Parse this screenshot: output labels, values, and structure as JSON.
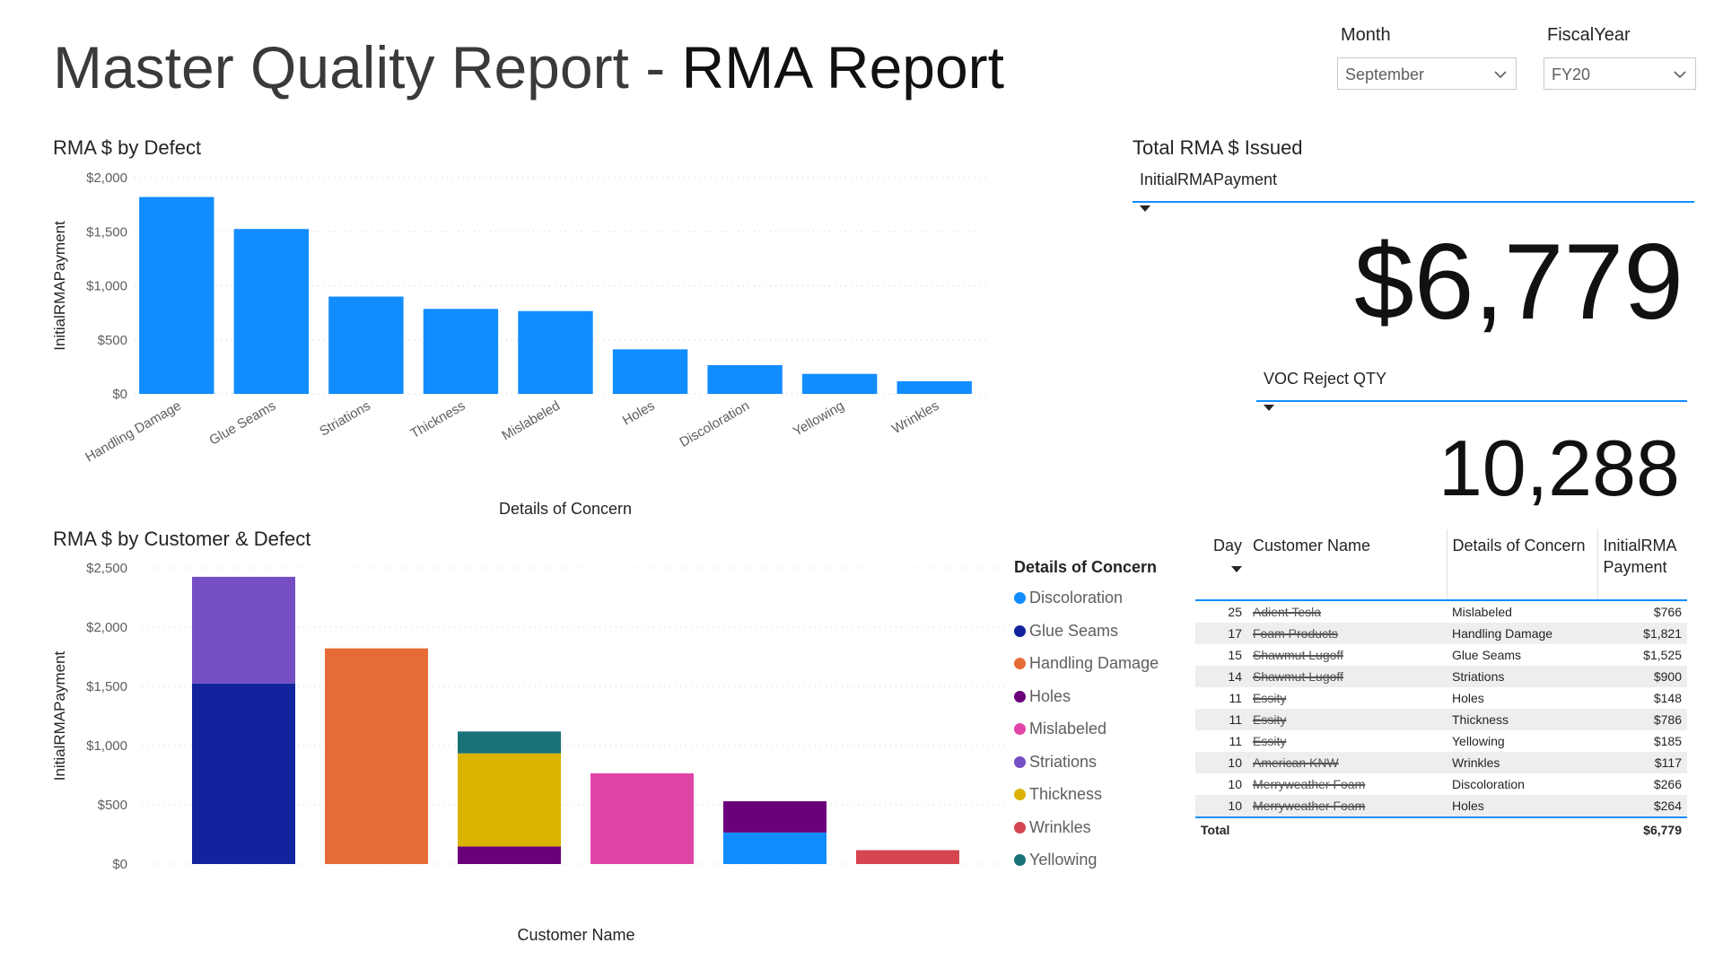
{
  "report": {
    "title_light": "Master Quality Report - ",
    "title_strong": "RMA Report"
  },
  "slicers": [
    {
      "label": "Month",
      "value": "September"
    },
    {
      "label": "FiscalYear",
      "value": "FY20"
    }
  ],
  "cards": {
    "total_title": "Total RMA $ Issued",
    "total_field": "InitialRMAPayment",
    "total_value": "$6,779",
    "voc_field": "VOC Reject QTY",
    "voc_value": "10,288"
  },
  "chart_data": [
    {
      "type": "bar",
      "title": "RMA $ by Defect",
      "xlabel": "Details of Concern",
      "ylabel": "InitialRMAPayment",
      "categories": [
        "Handling Damage",
        "Glue Seams",
        "Striations",
        "Thickness",
        "Mislabeled",
        "Holes",
        "Discoloration",
        "Yellowing",
        "Wrinkles"
      ],
      "values": [
        1821,
        1525,
        900,
        786,
        766,
        412,
        266,
        185,
        117
      ],
      "ylim": [
        0,
        2000
      ],
      "yticks": [
        "$0",
        "$500",
        "$1,000",
        "$1,500",
        "$2,000"
      ],
      "color": "#118dff",
      "grid": true
    },
    {
      "type": "bar",
      "stacked": true,
      "title": "RMA $ by Customer & Defect",
      "xlabel": "Customer Name",
      "ylabel": "InitialRMAPayment",
      "ylim": [
        0,
        2500
      ],
      "yticks": [
        "$0",
        "$500",
        "$1,000",
        "$1,500",
        "$2,000",
        "$2,500"
      ],
      "legend_title": "Details of Concern",
      "legend": [
        {
          "name": "Discoloration",
          "color": "#118dff"
        },
        {
          "name": "Glue Seams",
          "color": "#12239e"
        },
        {
          "name": "Handling Damage",
          "color": "#e66c37"
        },
        {
          "name": "Holes",
          "color": "#6b007b"
        },
        {
          "name": "Mislabeled",
          "color": "#e044a7"
        },
        {
          "name": "Striations",
          "color": "#744ec2"
        },
        {
          "name": "Thickness",
          "color": "#d9b300"
        },
        {
          "name": "Wrinkles",
          "color": "#d64550"
        },
        {
          "name": "Yellowing",
          "color": "#197278"
        }
      ],
      "stacks": [
        [
          {
            "series": "Glue Seams",
            "value": 1525
          },
          {
            "series": "Striations",
            "value": 900
          }
        ],
        [
          {
            "series": "Handling Damage",
            "value": 1821
          }
        ],
        [
          {
            "series": "Holes",
            "value": 148
          },
          {
            "series": "Thickness",
            "value": 786
          },
          {
            "series": "Yellowing",
            "value": 185
          }
        ],
        [
          {
            "series": "Mislabeled",
            "value": 766
          }
        ],
        [
          {
            "series": "Discoloration",
            "value": 266
          },
          {
            "series": "Holes",
            "value": 264
          }
        ],
        [
          {
            "series": "Wrinkles",
            "value": 117
          }
        ]
      ],
      "grid": true
    }
  ],
  "table": {
    "headers": [
      "Day",
      "Customer Name",
      "Details of Concern",
      "InitialRMA Payment"
    ],
    "rows": [
      {
        "day": "25",
        "customer": "Adient Tesla",
        "concern": "Mislabeled",
        "payment": "$766"
      },
      {
        "day": "17",
        "customer": "Foam Products",
        "concern": "Handling Damage",
        "payment": "$1,821"
      },
      {
        "day": "15",
        "customer": "Shawmut Lugoff",
        "concern": "Glue Seams",
        "payment": "$1,525"
      },
      {
        "day": "14",
        "customer": "Shawmut Lugoff",
        "concern": "Striations",
        "payment": "$900"
      },
      {
        "day": "11",
        "customer": "Essity",
        "concern": "Holes",
        "payment": "$148"
      },
      {
        "day": "11",
        "customer": "Essity",
        "concern": "Thickness",
        "payment": "$786"
      },
      {
        "day": "11",
        "customer": "Essity",
        "concern": "Yellowing",
        "payment": "$185"
      },
      {
        "day": "10",
        "customer": "American KNW",
        "concern": "Wrinkles",
        "payment": "$117"
      },
      {
        "day": "10",
        "customer": "Merryweather Foam",
        "concern": "Discoloration",
        "payment": "$266"
      },
      {
        "day": "10",
        "customer": "Merryweather Foam",
        "concern": "Holes",
        "payment": "$264"
      }
    ],
    "total_label": "Total",
    "total_value": "$6,779"
  }
}
